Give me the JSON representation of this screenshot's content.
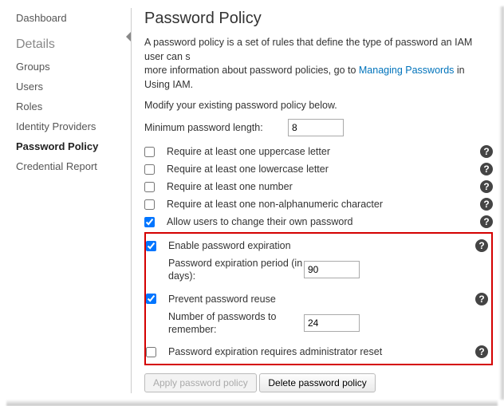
{
  "sidebar": {
    "top": "Dashboard",
    "section": "Details",
    "items": [
      "Groups",
      "Users",
      "Roles",
      "Identity Providers",
      "Password Policy",
      "Credential Report"
    ],
    "activeIndex": 4
  },
  "page": {
    "title": "Password Policy",
    "intro_a": "A password policy is a set of rules that define the type of password an IAM user can s",
    "intro_b": "more information about password policies, go to ",
    "intro_link": "Managing Passwords",
    "intro_c": " in Using IAM.",
    "modify": "Modify your existing password policy below.",
    "min_len_label": "Minimum password length:",
    "min_len_value": "8"
  },
  "options": [
    {
      "label": "Require at least one uppercase letter",
      "checked": false,
      "help": true
    },
    {
      "label": "Require at least one lowercase letter",
      "checked": false,
      "help": true
    },
    {
      "label": "Require at least one number",
      "checked": false,
      "help": true
    },
    {
      "label": "Require at least one non-alphanumeric character",
      "checked": false,
      "help": true
    },
    {
      "label": "Allow users to change their own password",
      "checked": true,
      "help": true
    }
  ],
  "highlight": {
    "expire": {
      "checked": true,
      "label": "Enable password expiration",
      "sub_label": "Password expiration period (in days):",
      "value": "90"
    },
    "reuse": {
      "checked": true,
      "label": "Prevent password reuse",
      "sub_label": "Number of passwords to remember:",
      "value": "24"
    },
    "admin_reset": {
      "checked": false,
      "label": "Password expiration requires administrator reset"
    }
  },
  "buttons": {
    "apply": "Apply password policy",
    "delete": "Delete password policy"
  }
}
